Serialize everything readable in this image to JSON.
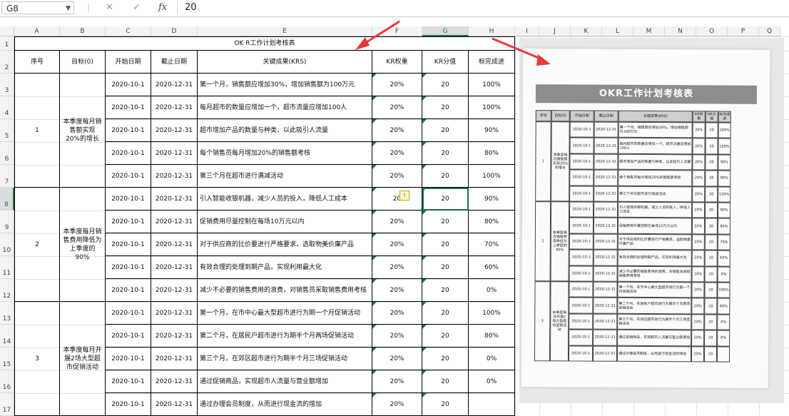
{
  "formula_bar": {
    "cell_ref": "G8",
    "cancel_icon": "✕",
    "confirm_icon": "✓",
    "fx_label": "fx",
    "value": "20"
  },
  "columns": [
    "A",
    "B",
    "C",
    "D",
    "E",
    "F",
    "G",
    "H",
    "I",
    "J",
    "K",
    "L",
    "M",
    "N",
    "O",
    "P",
    "Q"
  ],
  "rows": [
    "1",
    "2",
    "3",
    "4",
    "5",
    "6",
    "7",
    "8",
    "9",
    "10",
    "11",
    "12",
    "13",
    "14",
    "15",
    "16",
    "17"
  ],
  "sheet": {
    "title": "OK R工作计划考核表",
    "headers": {
      "seq": "序号",
      "objective": "目标(0)",
      "start": "开始日期",
      "end": "截止日期",
      "kr": "关键成果(KRS)",
      "weight": "KR权重",
      "score": "KR分值",
      "progress": "标完成进"
    },
    "groups": [
      {
        "seq": "1",
        "objective": "本季度每月销售额实现20%的增长"
      },
      {
        "seq": "2",
        "objective": "本季度每月销售费用降低为上季度的90%"
      },
      {
        "seq": "3",
        "objective": "本季度每月开展2场大型超市促销活动"
      }
    ],
    "rows": [
      {
        "start": "2020-10-1",
        "end": "2020-12-31",
        "kr": "第一个月，销售额应增加30%，增加销售额为100万元",
        "weight": "20%",
        "score": "20",
        "progress": "100%"
      },
      {
        "start": "2020-10-1",
        "end": "2020-12-31",
        "kr": "每月超市的数量应增加一个，超市流量应增加100人",
        "weight": "20%",
        "score": "20",
        "progress": "100%"
      },
      {
        "start": "2020-10-1",
        "end": "2020-12-31",
        "kr": "超市增加产品的数量与种类，以此吸引人流量",
        "weight": "20%",
        "score": "20",
        "progress": "90%"
      },
      {
        "start": "2020-10-1",
        "end": "2020-12-31",
        "kr": "每个销售员每月增加20%的销售额考核",
        "weight": "20%",
        "score": "20",
        "progress": "80%"
      },
      {
        "start": "2020-10-1",
        "end": "2020-12-31",
        "kr": "第三个月在超市进行满减活动",
        "weight": "20%",
        "score": "20",
        "progress": "100%"
      },
      {
        "start": "2020-10-1",
        "end": "2020-12-31",
        "kr": "引入智能收银机器，减少人员的投入，降低人工成本",
        "weight": "20",
        "score": "20",
        "progress": "90%"
      },
      {
        "start": "2020-10-1",
        "end": "2020-12-31",
        "kr": "促销费用尽量控制在每场10万元以内",
        "weight": "20%",
        "score": "20",
        "progress": "80%"
      },
      {
        "start": "2020-10-1",
        "end": "2020-12-31",
        "kr": "对于供应商的比价要进行严格要求，选取物美价廉产品",
        "weight": "20%",
        "score": "20",
        "progress": "70%"
      },
      {
        "start": "2020-10-1",
        "end": "2020-12-31",
        "kr": "有效合理的处理到期产品，实现利用最大化",
        "weight": "20%",
        "score": "20",
        "progress": "60%"
      },
      {
        "start": "2020-10-1",
        "end": "2020-12-31",
        "kr": "减少不必要的销售费用的浪费，对销售员采取销售费用考核",
        "weight": "20%",
        "score": "20",
        "progress": "0%"
      },
      {
        "start": "2020-10-1",
        "end": "2020-12-31",
        "kr": "第一个月，在市中心最大型超市进行为期一个月促销活动",
        "weight": "20%",
        "score": "20",
        "progress": "100%"
      },
      {
        "start": "2020-10-1",
        "end": "2020-12-31",
        "kr": "第二个月，在居民户超市进行为期半个月两场促销活动",
        "weight": "20%",
        "score": "20",
        "progress": "80%"
      },
      {
        "start": "2020-10-1",
        "end": "2020-12-31",
        "kr": "第三个月，在郊区超市进行为期半个月三场促销活动",
        "weight": "20%",
        "score": "20",
        "progress": "0%"
      },
      {
        "start": "2020-10-1",
        "end": "2020-12-31",
        "kr": "通过促销商品，实现超市人流量与营业额增加",
        "weight": "20%",
        "score": "20",
        "progress": "0%"
      },
      {
        "start": "2020-10-1",
        "end": "2020-12-31",
        "kr": "通过办理会员制度，从而进行现金流的增加",
        "weight": "20%",
        "score": "20",
        "progress": ""
      }
    ]
  },
  "photo": {
    "title": "OKR工作计划考核表",
    "headers": [
      "序号",
      "目标(0)",
      "开始日期",
      "截止日期",
      "关键成果(KRS)",
      "KR权重",
      "KR分值",
      "标完成进"
    ],
    "groups": [
      {
        "seq": "1",
        "objective": "本季度每月销售额实现20%的增长"
      },
      {
        "seq": "2",
        "objective": "本季度每月销售费用降低为上季度的90%"
      },
      {
        "seq": "3",
        "objective": "本季度每月开展2场大型超市促销活动"
      }
    ],
    "rows": [
      {
        "start": "2020-10-1",
        "end": "2020-12-31",
        "kr": "第一个月，销售额应增加30%，增加销售额为100万元",
        "weight": "20%",
        "score": "20",
        "progress": "100%"
      },
      {
        "start": "2020-10-1",
        "end": "2020-12-31",
        "kr": "每月超市的数量应增加一个，超市流量应增加100人",
        "weight": "20%",
        "score": "20",
        "progress": "100%"
      },
      {
        "start": "2020-10-1",
        "end": "2020-12-31",
        "kr": "超市增加产品的数量与种类，以此吸引人流量",
        "weight": "20%",
        "score": "20",
        "progress": "90%"
      },
      {
        "start": "2020-10-1",
        "end": "2020-12-31",
        "kr": "每个销售员每月增加20%的销售额考核",
        "weight": "20%",
        "score": "20",
        "progress": "80%"
      },
      {
        "start": "2020-10-1",
        "end": "2020-12-31",
        "kr": "第三个月在超市进行满减活动",
        "weight": "20%",
        "score": "20",
        "progress": "100%"
      },
      {
        "start": "2020-10-1",
        "end": "2020-12-31",
        "kr": "引入智能收银机器，减少人员的投入，降低人工成本",
        "weight": "20%",
        "score": "20",
        "progress": "90%"
      },
      {
        "start": "2020-10-1",
        "end": "2020-12-31",
        "kr": "促销费用尽量控制在每场10万元以内",
        "weight": "20%",
        "score": "20",
        "progress": "80%"
      },
      {
        "start": "2020-10-1",
        "end": "2020-12-31",
        "kr": "对于供应商的比价要进行严格要求，选取物美价廉产品",
        "weight": "20%",
        "score": "20",
        "progress": "70%"
      },
      {
        "start": "2020-10-1",
        "end": "2020-12-31",
        "kr": "有效合理的处理到期产品，实现利用最大化",
        "weight": "20%",
        "score": "20",
        "progress": "60%"
      },
      {
        "start": "2020-10-1",
        "end": "2020-12-31",
        "kr": "减少不必要的销售费用的浪费，对销售员采取销售费用考核",
        "weight": "20%",
        "score": "20",
        "progress": "0%"
      },
      {
        "start": "2020-10-1",
        "end": "2020-12-31",
        "kr": "第一个月，在市中心最大型超市进行为期一个月促销活动",
        "weight": "20%",
        "score": "20",
        "progress": "100%"
      },
      {
        "start": "2020-10-1",
        "end": "2020-12-31",
        "kr": "第二个月，在居民户超市进行为期半个月两场促销活动",
        "weight": "20%",
        "score": "20",
        "progress": "80%"
      },
      {
        "start": "2020-10-1",
        "end": "2020-12-31",
        "kr": "第三个月，在郊区超市进行为期半个月三场促销活动",
        "weight": "20%",
        "score": "20",
        "progress": "0%"
      },
      {
        "start": "2020-10-1",
        "end": "2020-12-31",
        "kr": "通过促销商品，实现超市人流量与营业额增加",
        "weight": "20%",
        "score": "20",
        "progress": "0%"
      },
      {
        "start": "2020-10-1",
        "end": "2020-12-31",
        "kr": "通过办理会员制度，从而进行现金流的增加",
        "weight": "20%",
        "score": "20",
        "progress": ""
      }
    ]
  },
  "accent": "#217346",
  "arrow_color": "#e8393a"
}
